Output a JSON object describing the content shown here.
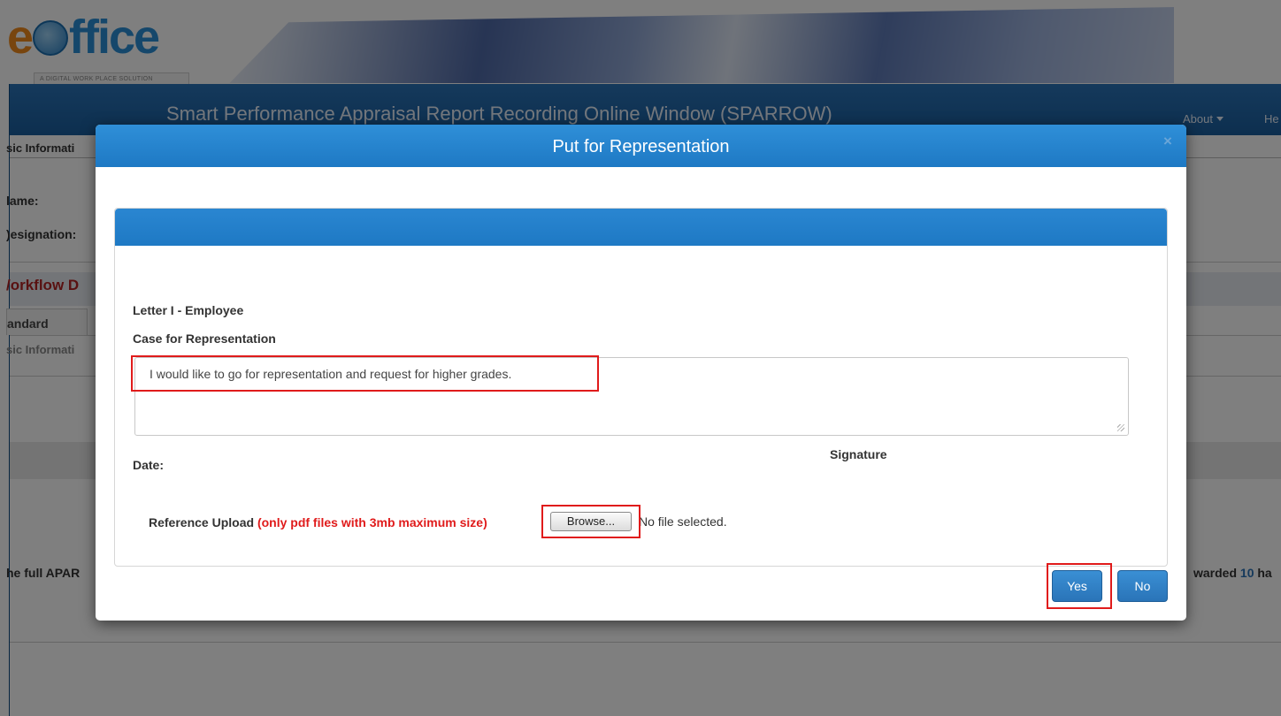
{
  "banner": {
    "logo_text_e": "e",
    "logo_text_rest": "ffice",
    "tagline": "A DIGITAL WORK PLACE SOLUTION"
  },
  "navbar": {
    "title": "Smart Performance Appraisal Report Recording Online Window (SPARROW)",
    "about_label": "About",
    "help_label": "He"
  },
  "background": {
    "basic_info": "sic Informati",
    "name_label": "lame:",
    "designation_label": ")esignation:",
    "workflow_label": "/orkflow D",
    "tab_standard": "andard",
    "tab_sub": "sic Informati",
    "full_apar_text": "he full APAR",
    "awarded_prefix": "warded ",
    "awarded_num": "10",
    "awarded_suffix": " ha"
  },
  "modal": {
    "title": "Put for Representation",
    "close_glyph": "×",
    "letter_label": "Letter I - Employee",
    "case_label": "Case for Representation",
    "case_value": "I would like to go for representation and request for higher grades.",
    "date_label": "Date:",
    "signature_label": "Signature",
    "upload_label": "Reference Upload",
    "upload_warning": "(only pdf files with 3mb maximum size)",
    "browse_label": "Browse...",
    "no_file_text": "No file selected.",
    "yes_label": "Yes",
    "no_label": "No"
  },
  "colors": {
    "header_blue": "#1e79c4",
    "annotation_red": "#e01b1b",
    "warning_red": "#e01b1b"
  }
}
